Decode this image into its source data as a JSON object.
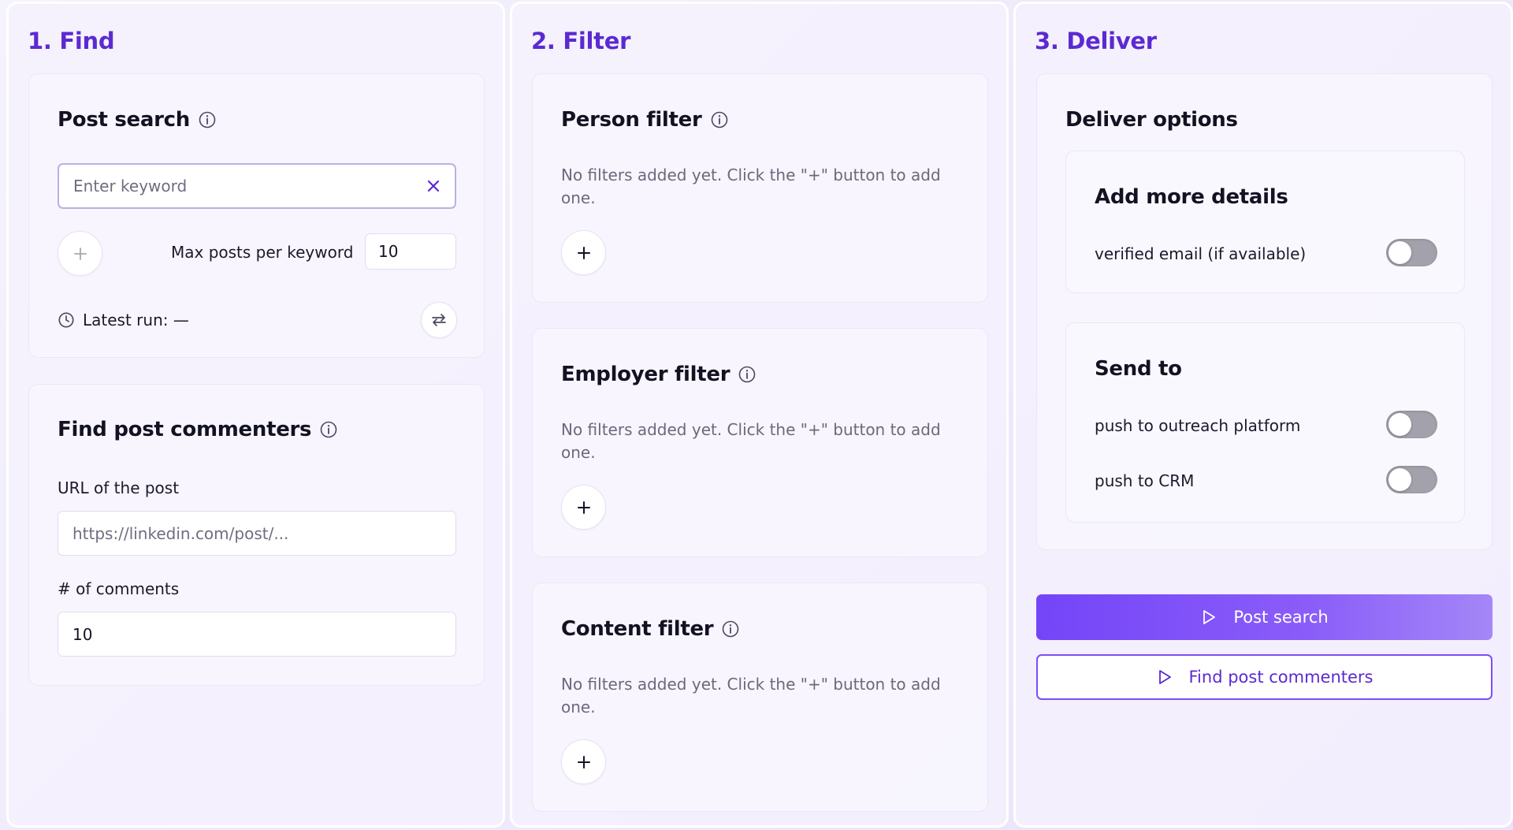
{
  "find": {
    "title": "1. Find",
    "post_search": {
      "title": "Post search",
      "keyword_placeholder": "Enter keyword",
      "max_posts_label": "Max posts per keyword",
      "max_posts_value": "10",
      "latest_run_label": "Latest run: —"
    },
    "commenters": {
      "title": "Find post commenters",
      "url_label": "URL of the post",
      "url_placeholder": "https://linkedin.com/post/...",
      "comments_label": "# of comments",
      "comments_value": "10"
    }
  },
  "filter": {
    "title": "2. Filter",
    "person": {
      "title": "Person filter",
      "empty": "No filters added yet. Click the \"+\" button to add one."
    },
    "employer": {
      "title": "Employer filter",
      "empty": "No filters added yet. Click the \"+\" button to add one."
    },
    "content": {
      "title": "Content filter",
      "empty": "No filters added yet. Click the \"+\" button to add one."
    }
  },
  "deliver": {
    "title": "3. Deliver",
    "options_title": "Deliver options",
    "details": {
      "title": "Add more details",
      "verified_email_label": "verified email (if available)",
      "verified_email_on": false
    },
    "send_to": {
      "title": "Send to",
      "outreach_label": "push to outreach platform",
      "outreach_on": false,
      "crm_label": "push to CRM",
      "crm_on": false
    },
    "post_search_button": "Post search",
    "find_commenters_button": "Find post commenters"
  },
  "colors": {
    "accent": "#5b2ad1",
    "primary_button": "#7445f8",
    "toggle_off": "#a3a1ab"
  },
  "icons": [
    "info-icon",
    "clear-icon",
    "plus-icon",
    "clock-icon",
    "refresh-icon",
    "play-icon"
  ]
}
